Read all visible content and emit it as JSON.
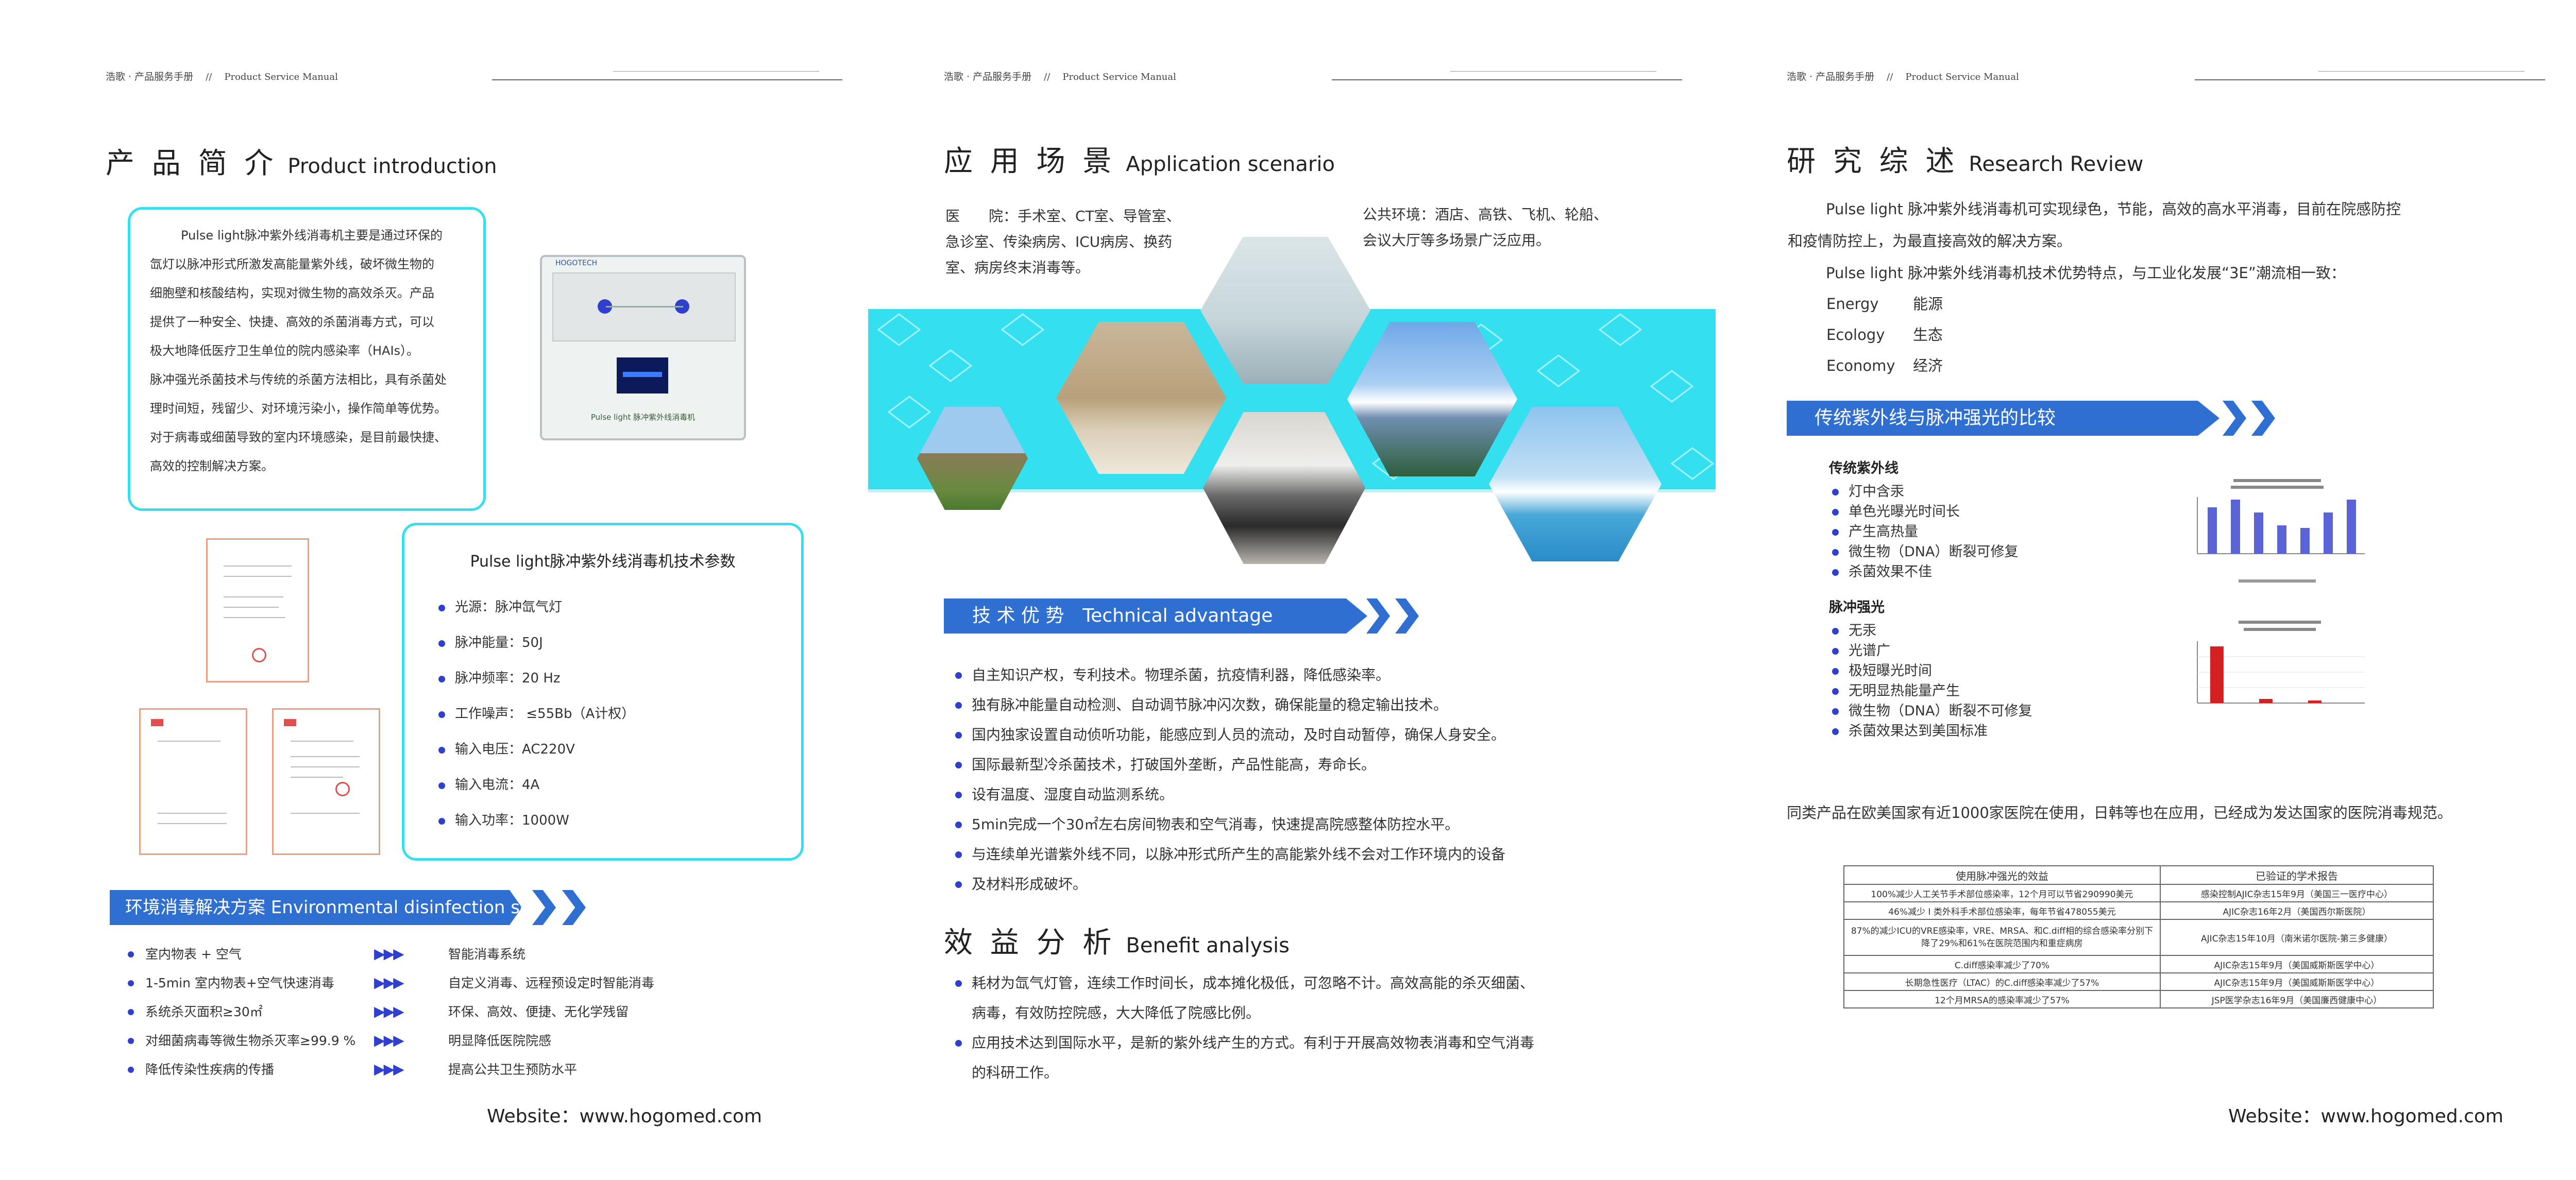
{
  "colors": {
    "accent_blue": "#2f6fd1",
    "bullet_blue": "#2f3fcf",
    "cyan": "#34e0f0"
  },
  "header": {
    "brand": "浩歌 · 产品服务手册",
    "sep": "//",
    "en": "Product Service Manual"
  },
  "website": "Website：www.hogomed.com",
  "p1": {
    "title_cn": "产 品 简 介",
    "title_en": "Product introduction",
    "intro": [
      "Pulse light脉冲紫外线消毒机主要是通过环保的",
      "氙灯以脉冲形式所激发高能量紫外线，破坏微生物的",
      "细胞壁和核酸结构，实现对微生物的高效杀灭。产品",
      "提供了一种安全、快捷、高效的杀菌消毒方式，可以",
      "极大地降低医疗卫生单位的院内感染率（HAIs）。",
      "脉冲强光杀菌技术与传统的杀菌方法相比，具有杀菌处",
      "理时间短，残留少、对环境污染小，操作简单等优势。",
      "对于病毒或细菌导致的室内环境感染，是目前最快捷、",
      "高效的控制解决方案。"
    ],
    "device_label": "Pulse light 脉冲紫外线消毒机",
    "device_brand": "HOGOTECH",
    "params_title": "Pulse light脉冲紫外线消毒机技术参数",
    "params": [
      "光源：脉冲氙气灯",
      "脉冲能量：50J",
      "脉冲频率：20 Hz",
      "工作噪声：  ≤55Bb（A计权）",
      "输入电压：AC220V",
      "输入电流：4A",
      "输入功率：1000W"
    ],
    "banner": "环境消毒解决方案 Environmental disinfection solutions",
    "solutions": [
      {
        "left": "室内物表 + 空气",
        "right": "智能消毒系统"
      },
      {
        "left": "1-5min 室内物表+空气快速消毒",
        "right": "自定义消毒、远程预设定时智能消毒"
      },
      {
        "left": "系统杀灭面积≥30㎡",
        "right": "环保、高效、便捷、无化学残留"
      },
      {
        "left": "对细菌病毒等微生物杀灭率≥99.9 %",
        "right": "明显降低医院院感"
      },
      {
        "left": "降低传染性疾病的传播",
        "right": "提高公共卫生预防水平"
      }
    ]
  },
  "p2": {
    "title_cn": "应 用 场 景",
    "title_en": "Application scenario",
    "medical": [
      "医　　院：手术室、CT室、导管室、",
      "急诊室、传染病房、ICU病房、换药",
      "室、病房终末消毒等。"
    ],
    "public": [
      "公共环境：酒店、高铁、飞机、轮船、",
      "会议大厅等多场景广泛应用。"
    ],
    "tech_banner": "技 术 优 势　Technical advantage",
    "tech": [
      "自主知识产权，专利技术。物理杀菌，抗疫情利器，降低感染率。",
      "独有脉冲能量自动检测、自动调节脉冲闪次数，确保能量的稳定输出技术。",
      "国内独家设置自动侦听功能，能感应到人员的流动，及时自动暂停，确保人身安全。",
      "国际最新型冷杀菌技术，打破国外垄断，产品性能高，寿命长。",
      "设有温度、湿度自动监测系统。",
      "5min完成一个30㎡左右房间物表和空气消毒，快速提高院感整体防控水平。",
      "与连续单光谱紫外线不同，以脉冲形式所产生的高能紫外线不会对工作环境内的设备",
      "及材料形成破坏。"
    ],
    "benefit_title_cn": "效 益 分 析",
    "benefit_title_en": "Benefit analysis",
    "benefit": [
      "耗材为氙气灯管，连续工作时间长，成本摊化极低，可忽略不计。高效高能的杀灭细菌、",
      "病毒，有效防控院感，大大降低了院感比例。",
      "应用技术达到国际水平，是新的紫外线产生的方式。有利于开展高效物表消毒和空气消毒",
      "的科研工作。"
    ]
  },
  "p3": {
    "title_cn": "研 究 综 述",
    "title_en": "Research Review",
    "para1": [
      "Pulse light 脉冲紫外线消毒机可实现绿色，节能，高效的高水平消毒，目前在院感防控",
      "和疫情防控上，为最直接高效的解决方案。"
    ],
    "para2": "Pulse light 脉冲紫外线消毒机技术优势特点，与工业化发展“3E”潮流相一致：",
    "e3": [
      {
        "en": "Energy",
        "cn": "能源"
      },
      {
        "en": "Ecology",
        "cn": "生态"
      },
      {
        "en": "Economy",
        "cn": "经济"
      }
    ],
    "compare_banner": "传统紫外线与脉冲强光的比较",
    "trad_title": "传统紫外线",
    "trad": [
      "灯中含汞",
      "单色光曝光时间长",
      "产生高热量",
      "微生物（DNA）断裂可修复",
      "杀菌效果不佳"
    ],
    "pulse_title": "脉冲强光",
    "pulse": [
      "无汞",
      "光谱广",
      "极短曝光时间",
      "无明显热能量产生",
      "微生物（DNA）断裂不可修复",
      "杀菌效果达到美国标准"
    ],
    "summary": "同类产品在欧美国家有近1000家医院在使用，日韩等也在应用，已经成为发达国家的医院消毒规范。",
    "table_headers": [
      "使用脉冲强光的效益",
      "已验证的学术报告"
    ],
    "table_rows": [
      [
        "100%减少人工关节手术部位感染率，12个月可以节省290990美元",
        "感染控制AJIC杂志15年9月（美国三一医疗中心）"
      ],
      [
        "46%减少 I 类外科手术部位感染率，每年节省478055美元",
        "AJIC杂志16年2月（美国西尔斯医院）"
      ],
      [
        "87%的减少ICU的VRE感染率，VRE、MRSA、和C.diff相的综合感染率分别下降了29%和61%在医院范围内和重症病房",
        "AJIC杂志15年10月（南米诺尔医院-第三多健康）"
      ],
      [
        "C.diff感染率减少了70%",
        "AJIC杂志15年9月（美国威斯斯医学中心）"
      ],
      [
        "长期急性医疗（LTAC）的C.diff感染率减少了57%",
        "AJIC杂志15年9月（美国威斯斯医学中心）"
      ],
      [
        "12个月MRSA的感染率减少了57%",
        "JSP医学杂志16年9月（美国廉西健康中心）"
      ]
    ]
  }
}
